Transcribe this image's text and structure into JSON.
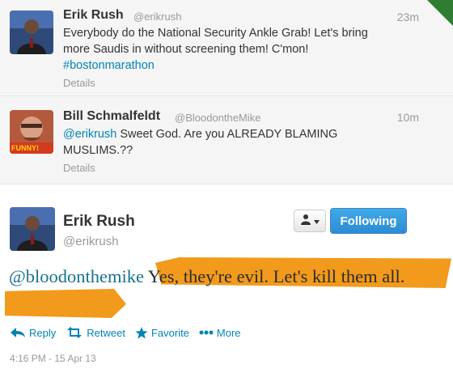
{
  "timeline": [
    {
      "name": "Erik Rush",
      "handle": "@erikrush",
      "time": "23m",
      "text_line1": "Everybody do the National Security Ankle Grab! Let's bring",
      "text_line2": "more Saudis in without screening them! C'mon!",
      "hashtag": "#bostonmarathon",
      "details_label": "Details"
    },
    {
      "name": "Bill Schmalfeldt",
      "handle": "@BloodontheMike",
      "time": "10m",
      "mention": "@erikrush",
      "text_line1_rest": " Sweet God. Are you ALREADY BLAMING",
      "text_line2": "MUSLIMS.??",
      "details_label": "Details",
      "avatar_caption": "FUNNY!"
    }
  ],
  "main_tweet": {
    "name": "Erik Rush",
    "handle": "@erikrush",
    "mention": "@bloodonthemike",
    "text_rest": " Yes, they're evil. Let's kill them all.",
    "timestamp": "4:16 PM - 15 Apr 13"
  },
  "buttons": {
    "follow": "Following"
  },
  "actions": {
    "reply": "Reply",
    "retweet": "Retweet",
    "favorite": "Favorite",
    "more": "More"
  },
  "colors": {
    "link": "#0084b4",
    "highlight": "#f29a1b",
    "following_button": "#2b8cd4"
  }
}
